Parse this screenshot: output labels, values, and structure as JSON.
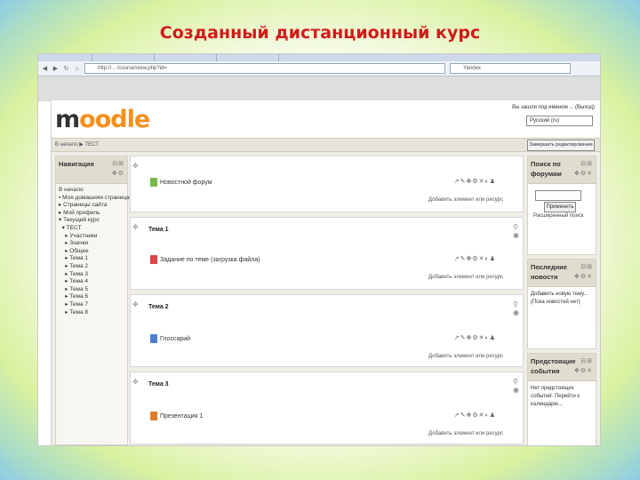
{
  "slide_title": "Созданный дистанционный курс",
  "browser": {
    "address": "http://... /course/view.php?id=",
    "search": "Yandex"
  },
  "moodle": {
    "logo_prefix": "m",
    "logo_rest": "oodle",
    "login_info": "Вы зашли под именем ...  (Выход)",
    "language": "Русский (ru)",
    "crumb": "В начало ▶ ТЕСТ",
    "edit_button": "Завершить редактирование"
  },
  "left_block": {
    "title": "Навигация",
    "items": [
      "В начало",
      "▪ Моя домашняя страница",
      "▸ Страницы сайта",
      "▸ Мой профиль",
      "▾ Текущий курс",
      "  ▾ ТЕСТ",
      "    ▸ Участники",
      "    ▸ Значки",
      "    ▸ Общее",
      "    ▸ Тема 1",
      "    ▸ Тема 2",
      "    ▸ Тема 3",
      "    ▸ Тема 4",
      "    ▸ Тема 5",
      "    ▸ Тема 6",
      "    ▸ Тема 7",
      "    ▸ Тема 8"
    ]
  },
  "sections": [
    {
      "title": "",
      "activity": "Новостной форум",
      "icon_color": "#7ab648",
      "add": "Добавить элемент или ресурс"
    },
    {
      "title": "Тема 1",
      "activity": "Задание по теме (загрузка файла)",
      "icon_color": "#d44",
      "add": "Добавить элемент или ресурс"
    },
    {
      "title": "Тема 2",
      "activity": "Глоссарий",
      "icon_color": "#4a7fd0",
      "add": "Добавить элемент или ресурс"
    },
    {
      "title": "Тема 3",
      "activity": "Презентация 1",
      "icon_color": "#e07a2a",
      "add": "Добавить элемент или ресурс"
    }
  ],
  "right_blocks": {
    "search_title": "Поиск по форумам",
    "search_button": "Применить",
    "search_advanced": "Расширенный поиск",
    "news_title": "Последние новости",
    "news_text": "Добавить новую тему... (Пока новостей нет)",
    "events_title": "Предстоящие события",
    "events_text": "Нет предстоящих событий. Перейти к календарю..."
  }
}
